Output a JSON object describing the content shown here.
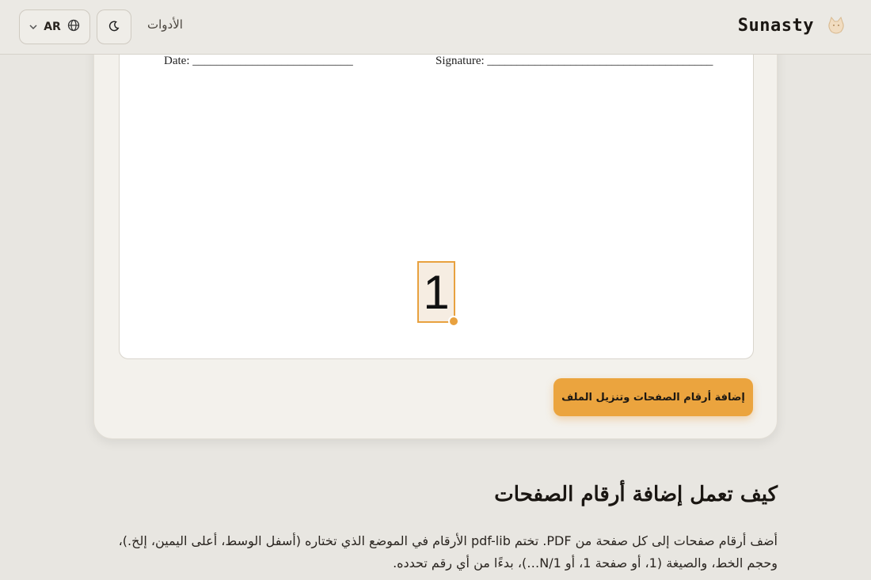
{
  "header": {
    "language": "AR",
    "tools_label": "الأدوات",
    "brand_name": "Sunasty"
  },
  "preview": {
    "date_label": "Date: ___________________________",
    "signature_label": "Signature: ______________________________________",
    "page_number": "1"
  },
  "actions": {
    "download_label": "إضافة أرقام الصفحات وتنزيل الملف"
  },
  "info": {
    "title": "كيف تعمل إضافة أرقام الصفحات",
    "body": "أضف أرقام صفحات إلى كل صفحة من PDF. تختم pdf-lib الأرقام في الموضع الذي تختاره (أسفل الوسط، أعلى اليمين، إلخ.)، وحجم الخط، والصيغة (1، أو صفحة 1، أو N/1…)، بدءًا من أي رقم تحدده."
  },
  "colors": {
    "accent": "#eba43e",
    "background": "#e8e6e1",
    "card": "#f3f1ec"
  },
  "icons": {
    "language": "globe-icon",
    "dropdown": "chevron-down-icon",
    "theme": "moon-icon",
    "brand": "cat-logo-icon"
  }
}
